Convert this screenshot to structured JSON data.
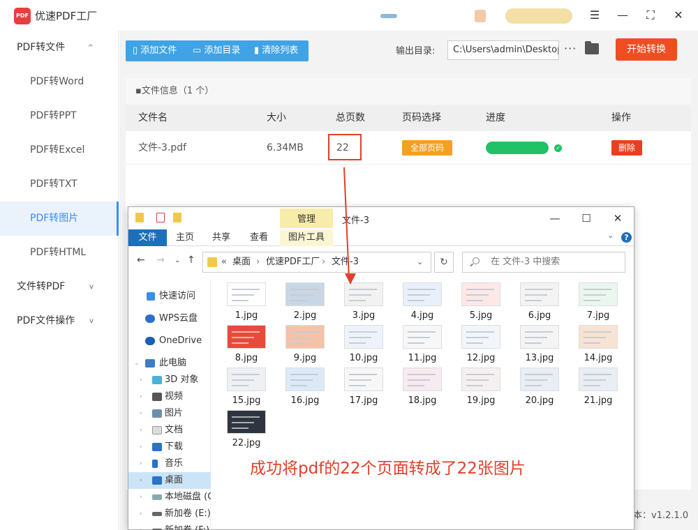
{
  "app": {
    "title": "优速PDF工厂",
    "logo_text": "PDF",
    "version": "本：v1.2.1.0"
  },
  "window_controls": {
    "menu": "☰",
    "minimize": "—",
    "maximize": "⛶",
    "close": "✕"
  },
  "sidebar": {
    "groups": [
      {
        "label": "PDF转文件",
        "chevron": "^"
      },
      {
        "label": "文件转PDF",
        "chevron": "v"
      },
      {
        "label": "PDF文件操作",
        "chevron": "v"
      }
    ],
    "items": [
      "PDF转Word",
      "PDF转PPT",
      "PDF转Excel",
      "PDF转TXT",
      "PDF转图片",
      "PDF转HTML"
    ],
    "active_index": 4
  },
  "toolbar": {
    "add_file": "添加文件",
    "add_dir": "添加目录",
    "clear_list": "清除列表",
    "output_label": "输出目录:",
    "output_path": "C:\\Users\\admin\\Desktop",
    "more": "···",
    "start": "开始转换"
  },
  "file_panel": {
    "header": "文件信息（1 个）",
    "columns": [
      "文件名",
      "大小",
      "总页数",
      "页码选择",
      "进度",
      "操作"
    ],
    "rows": [
      {
        "name": "文件-3.pdf",
        "size": "6.34MB",
        "pages": "22",
        "page_select": "全部页码",
        "progress": 1.0,
        "action": "删除"
      }
    ]
  },
  "explorer": {
    "manage": "管理",
    "title": "文件-3",
    "tabs": [
      "文件",
      "主页",
      "共享",
      "查看",
      "图片工具"
    ],
    "address": [
      "«",
      "桌面",
      "›",
      "优速PDF工厂",
      "›",
      "文件-3"
    ],
    "search_placeholder": "在 文件-3 中搜索",
    "nav": [
      "快速访问",
      "WPS云盘",
      "OneDrive",
      "此电脑",
      "3D 对象",
      "视频",
      "图片",
      "文档",
      "下载",
      "音乐",
      "桌面",
      "本地磁盘 (C",
      "新加卷 (E:)",
      "新加卷 (F:)"
    ],
    "files": [
      "1.jpg",
      "2.jpg",
      "3.jpg",
      "4.jpg",
      "5.jpg",
      "6.jpg",
      "7.jpg",
      "8.jpg",
      "9.jpg",
      "10.jpg",
      "11.jpg",
      "12.jpg",
      "13.jpg",
      "14.jpg",
      "15.jpg",
      "16.jpg",
      "17.jpg",
      "18.jpg",
      "19.jpg",
      "20.jpg",
      "21.jpg",
      "22.jpg"
    ]
  },
  "annotation": {
    "caption": "成功将pdf的22个页面转成了22张图片"
  },
  "colors": {
    "accent": "#3b8df0",
    "toolbar_blue": "#3fa3e6",
    "start_red": "#f04d22",
    "progress_green": "#21c167",
    "badge_orange": "#f5a022",
    "annotation_red": "#e0402b"
  }
}
